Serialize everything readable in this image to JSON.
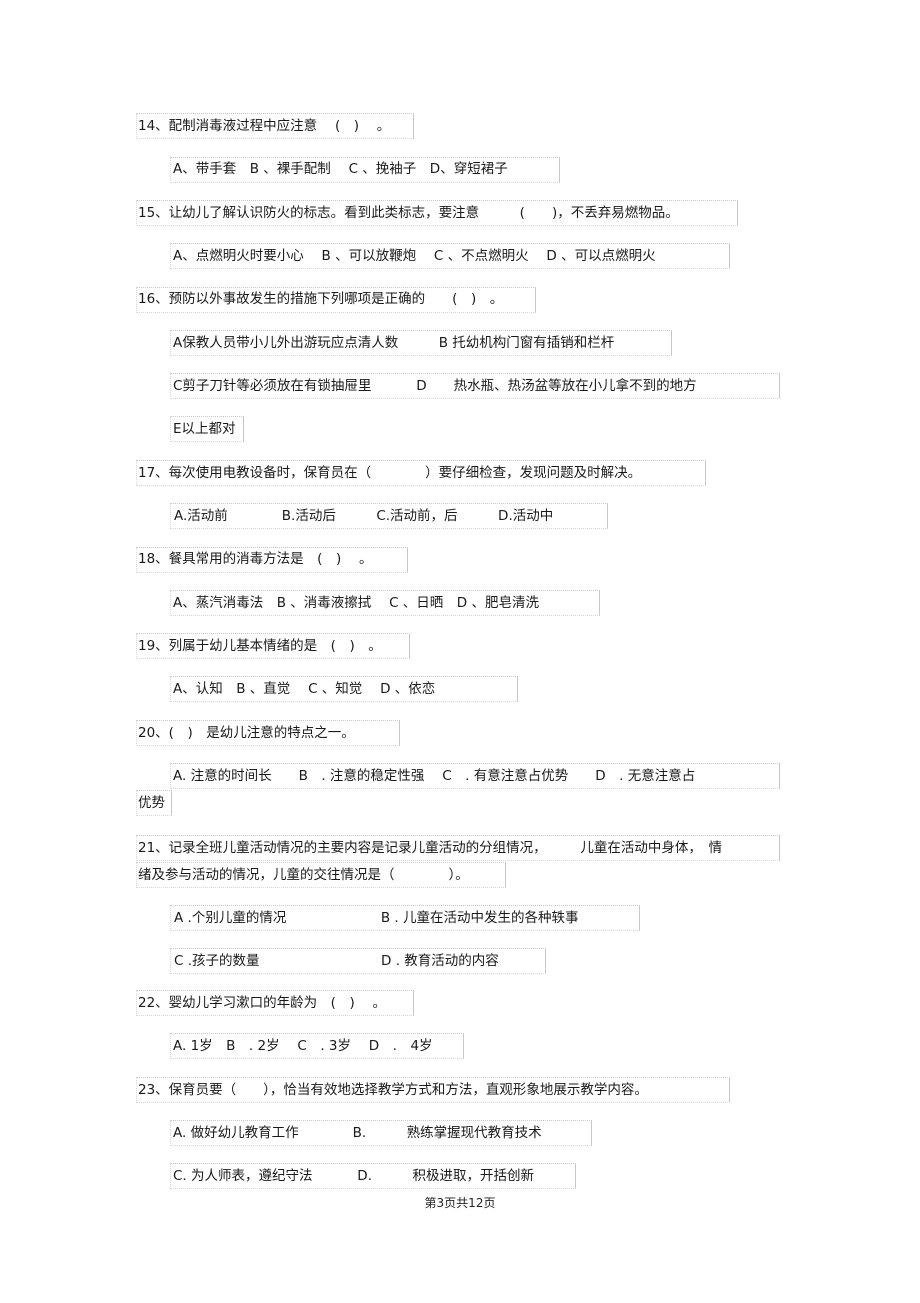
{
  "questions": [
    {
      "number": "14",
      "stem": "14、配制消毒液过程中应注意　 (　)　 。",
      "options": [
        "A、带手套　B 、裸手配制　 C 、挽袖子　D、穿短裙子"
      ]
    },
    {
      "number": "15",
      "stem": "15、让幼儿了解认识防火的标志。看到此类标志，要注意　　　(　　)，不丢弃易燃物品。",
      "options": [
        "A、点燃明火时要小心　 B 、可以放鞭炮　 C 、不点燃明火　 D 、可以点燃明火"
      ]
    },
    {
      "number": "16",
      "stem": "16、预防以外事故发生的措施下列哪项是正确的　　(　)　。",
      "options": [
        "A保教人员带小儿外出游玩应点清人数　　　B 托幼机构门窗有插销和栏杆",
        "C剪子刀针等必须放在有锁抽屉里　　　 D　　热水瓶、热汤盆等放在小儿拿不到的地方",
        "E以上都对"
      ]
    },
    {
      "number": "17",
      "stem": "17、每次使用电教设备时，保育员在（　　　　）要仔细检查，发现问题及时解决。",
      "options": [
        "A.活动前　　　　B.活动后　　　C.活动前，后　　　D.活动中"
      ]
    },
    {
      "number": "18",
      "stem": "18、餐具常用的消毒方法是　(　)　 。",
      "options": [
        "A、蒸汽消毒法　B 、消毒液擦拭　 C 、日晒　D 、肥皂清洗"
      ]
    },
    {
      "number": "19",
      "stem": "19、列属于幼儿基本情绪的是　(　)　。",
      "options": [
        "A、认知　B 、直觉　 C 、知觉　 D 、依恋"
      ]
    },
    {
      "number": "20",
      "stem": "20、(　)　是幼儿注意的特点之一。",
      "options": [
        "A. 注意的时间长　　B　. 注意的稳定性强　 C　. 有意注意占优势　　D　. 无意注意占",
        "优势"
      ]
    },
    {
      "number": "21",
      "stem": "21、记录全班儿童活动情况的主要内容是记录儿童活动的分组情况，　　　儿童在活动中身体，　情",
      "stem_continued": "绪及参与活动的情况，儿童的交往情况是（　　　　）。",
      "options": [
        "A .个别儿童的情况　　　　　　　B . 儿童在活动中发生的各种轶事",
        "C .孩子的数量　　　　　　　　　D . 教育活动的内容"
      ]
    },
    {
      "number": "22",
      "stem": "22、婴幼儿学习漱口的年龄为　(　)　 。",
      "options": [
        "A. 1岁　B　. 2岁　 C　. 3岁　 D　.　4岁"
      ]
    },
    {
      "number": "23",
      "stem": "23、保育员要（　　），恰当有效地选择教学方式和方法，直观形象地展示教学内容。",
      "options": [
        "A. 做好幼儿教育工作　　　　B.　　　熟练掌握现代教育技术",
        "C. 为人师表，遵纪守法　　　 D.　　　积极进取，开括创新"
      ]
    }
  ],
  "footer": {
    "page_label": "第3页共12页",
    "current_page": 3,
    "total_pages": 12
  }
}
